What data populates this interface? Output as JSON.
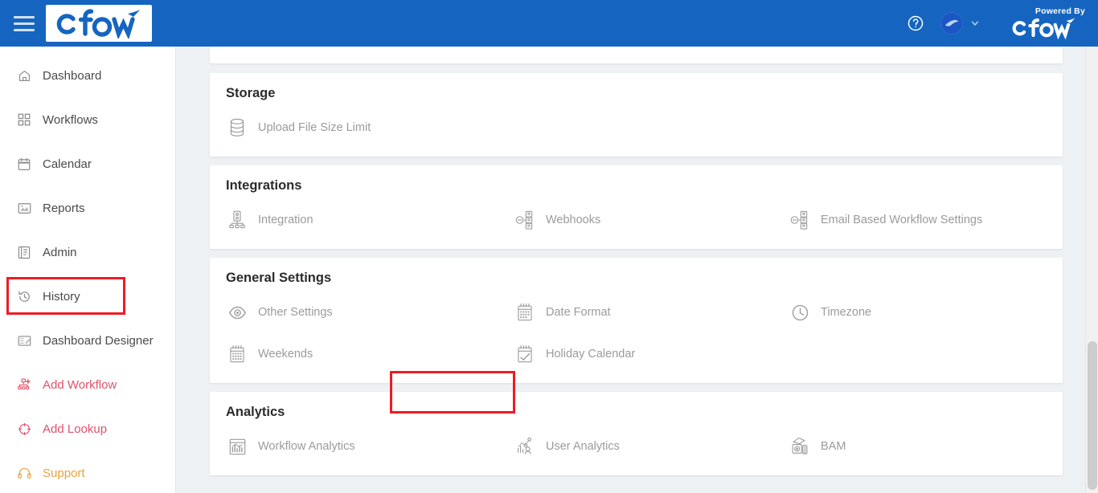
{
  "topbar": {
    "menu_icon": "hamburger-icon",
    "logo_text": "cflow",
    "help_icon": "help-circle-icon",
    "avatar_icon": "user-avatar",
    "chevron_icon": "chevron-down-icon",
    "powered_by_label": "Powered By",
    "powered_by_logo_text": "cflow",
    "background_color": "#1565c0"
  },
  "sidebar": {
    "items": [
      {
        "label": "Dashboard",
        "icon": "home-icon",
        "style": "default"
      },
      {
        "label": "Workflows",
        "icon": "grid-squares-icon",
        "style": "default"
      },
      {
        "label": "Calendar",
        "icon": "calendar-icon",
        "style": "default"
      },
      {
        "label": "Reports",
        "icon": "report-image-icon",
        "style": "default"
      },
      {
        "label": "Admin",
        "icon": "book-admin-icon",
        "style": "default"
      },
      {
        "label": "History",
        "icon": "clock-history-icon",
        "style": "default"
      },
      {
        "label": "Dashboard Designer",
        "icon": "designer-board-icon",
        "style": "default"
      },
      {
        "label": "Add Workflow",
        "icon": "add-workflow-icon",
        "style": "red"
      },
      {
        "label": "Add Lookup",
        "icon": "add-lookup-icon",
        "style": "red"
      },
      {
        "label": "Support",
        "icon": "headset-icon",
        "style": "gold"
      }
    ],
    "highlight": {
      "item": "Admin",
      "color": "#ee1b24"
    }
  },
  "main": {
    "sections": [
      {
        "title": "Storage",
        "options": [
          {
            "label": "Upload File Size Limit",
            "icon": "database-icon"
          }
        ]
      },
      {
        "title": "Integrations",
        "options": [
          {
            "label": "Integration",
            "icon": "server-integration-icon"
          },
          {
            "label": "Webhooks",
            "icon": "webhook-icon"
          },
          {
            "label": "Email Based Workflow Settings",
            "icon": "webhook-email-icon"
          }
        ]
      },
      {
        "title": "General Settings",
        "options": [
          {
            "label": "Other Settings",
            "icon": "eye-icon"
          },
          {
            "label": "Date Format",
            "icon": "calendar-date-icon"
          },
          {
            "label": "Timezone",
            "icon": "clock-icon"
          },
          {
            "label": "Weekends",
            "icon": "calendar-weekend-icon"
          },
          {
            "label": "Holiday Calendar",
            "icon": "calendar-check-icon"
          }
        ]
      },
      {
        "title": "Analytics",
        "options": [
          {
            "label": "Workflow Analytics",
            "icon": "bar-chart-board-icon"
          },
          {
            "label": "User Analytics",
            "icon": "user-chart-icon"
          },
          {
            "label": "BAM",
            "icon": "bam-monitor-icon"
          }
        ]
      }
    ],
    "highlight": {
      "item": "Weekends",
      "color": "#ee1b24"
    }
  },
  "scrollbar": {
    "orientation": "vertical",
    "thumb_position": "lower"
  }
}
